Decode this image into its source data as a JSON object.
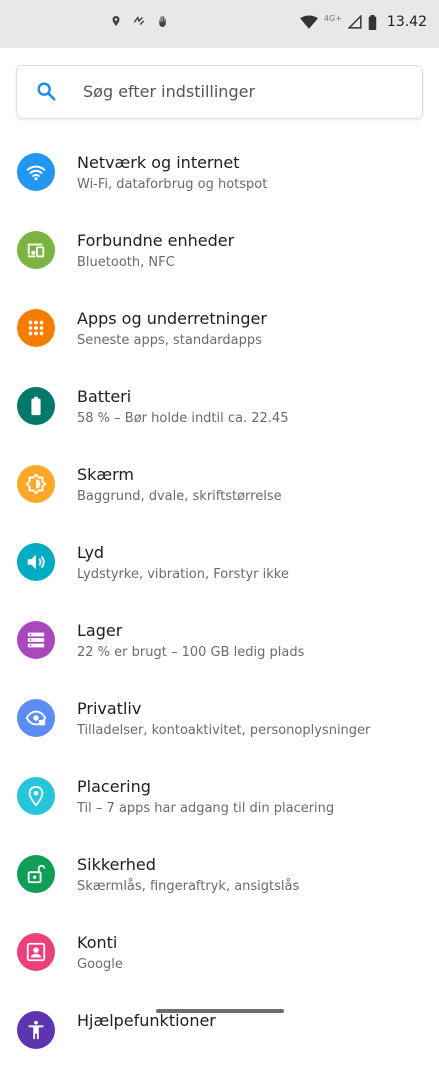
{
  "status_bar": {
    "time": "13.42",
    "network_type": "4G+",
    "icons": [
      "location-icon",
      "link-icon",
      "hand-icon",
      "wifi-icon",
      "signal-icon",
      "battery-icon"
    ]
  },
  "search": {
    "placeholder": "Søg efter indstillinger",
    "icon": "search-icon"
  },
  "settings": [
    {
      "id": "network",
      "title": "Netværk og internet",
      "subtitle": "Wi-Fi, dataforbrug og hotspot",
      "color": "#2196F3",
      "icon": "wifi-icon"
    },
    {
      "id": "devices",
      "title": "Forbundne enheder",
      "subtitle": "Bluetooth, NFC",
      "color": "#7CB342",
      "icon": "devices-icon"
    },
    {
      "id": "apps",
      "title": "Apps og underretninger",
      "subtitle": "Seneste apps, standardapps",
      "color": "#F57C00",
      "icon": "apps-grid-icon"
    },
    {
      "id": "battery",
      "title": "Batteri",
      "subtitle": "58 % – Bør holde indtil ca. 22.45",
      "color": "#00796B",
      "icon": "battery-icon"
    },
    {
      "id": "display",
      "title": "Skærm",
      "subtitle": "Baggrund, dvale, skriftstørrelse",
      "color": "#FFA726",
      "icon": "brightness-icon"
    },
    {
      "id": "sound",
      "title": "Lyd",
      "subtitle": "Lydstyrke, vibration, Forstyr ikke",
      "color": "#00ACC1",
      "icon": "volume-icon"
    },
    {
      "id": "storage",
      "title": "Lager",
      "subtitle": "22 % er brugt – 100 GB ledig plads",
      "color": "#AB47BC",
      "icon": "storage-icon"
    },
    {
      "id": "privacy",
      "title": "Privatliv",
      "subtitle": "Tilladelser, kontoaktivitet, personoplysninger",
      "color": "#5C8DF6",
      "icon": "privacy-eye-icon"
    },
    {
      "id": "location",
      "title": "Placering",
      "subtitle": "Til – 7 apps har adgang til din placering",
      "color": "#26C6DA",
      "icon": "location-pin-icon"
    },
    {
      "id": "security",
      "title": "Sikkerhed",
      "subtitle": "Skærmlås, fingeraftryk, ansigtslås",
      "color": "#0F9D58",
      "icon": "lock-open-icon"
    },
    {
      "id": "accounts",
      "title": "Konti",
      "subtitle": "Google",
      "color": "#EC407A",
      "icon": "account-box-icon"
    },
    {
      "id": "accessibility",
      "title": "Hjælpefunktioner",
      "subtitle": "",
      "color": "#5E35B1",
      "icon": "accessibility-icon"
    }
  ]
}
